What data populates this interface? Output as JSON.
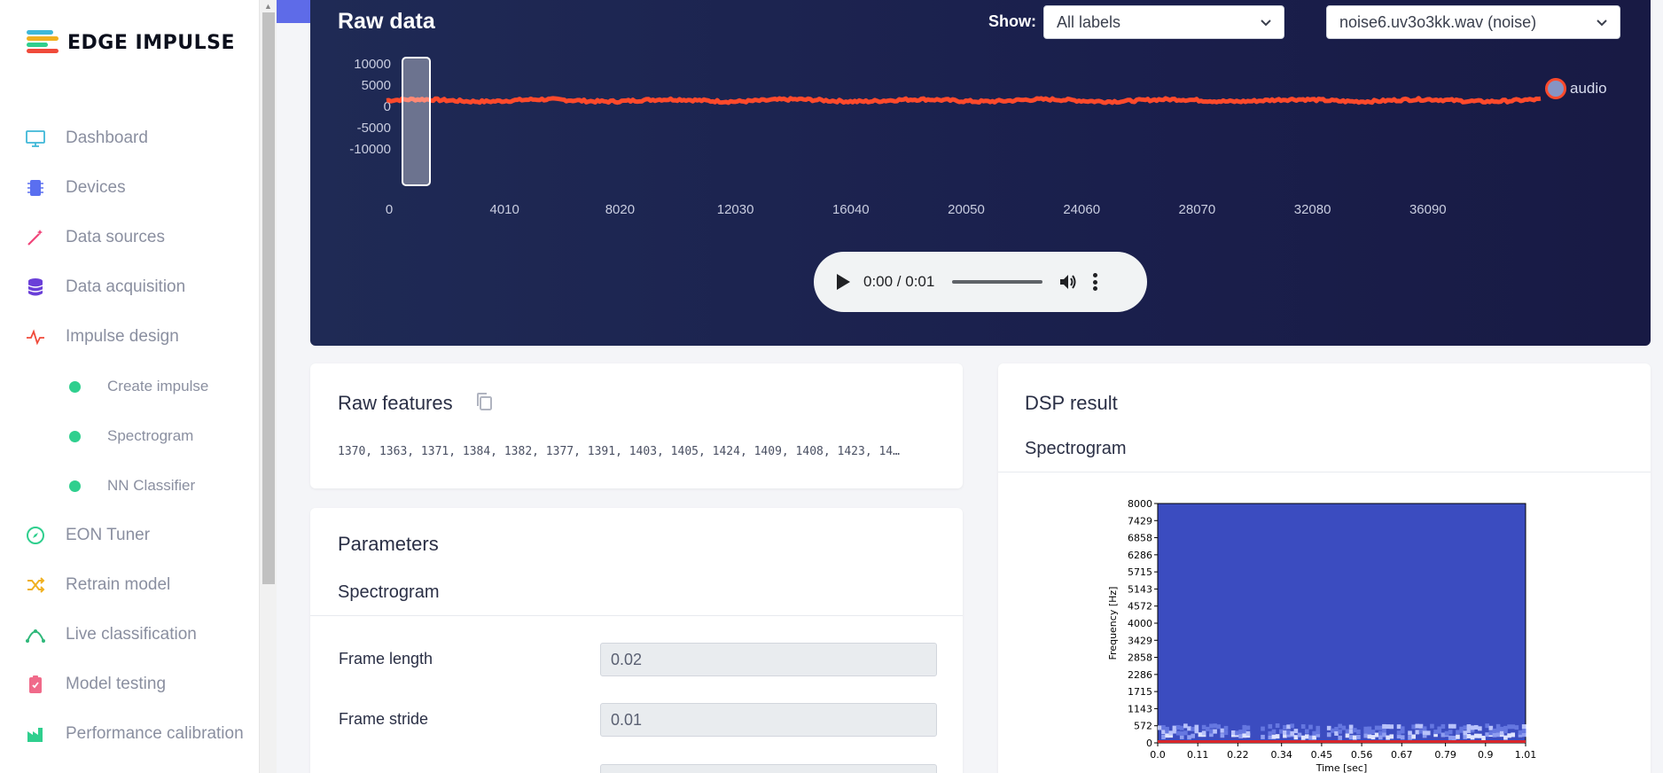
{
  "brand": {
    "name": "EDGE IMPULSE"
  },
  "nav": {
    "items": [
      {
        "label": "Dashboard",
        "icon": "monitor-icon",
        "color": "#3fb8d8"
      },
      {
        "label": "Devices",
        "icon": "chip-icon",
        "color": "#5a6ff0"
      },
      {
        "label": "Data sources",
        "icon": "wand-icon",
        "color": "#f0457a"
      },
      {
        "label": "Data acquisition",
        "icon": "database-icon",
        "color": "#6a3fd8"
      },
      {
        "label": "Impulse design",
        "icon": "pulse-icon",
        "color": "#f04a3a"
      }
    ],
    "sub_items": [
      {
        "label": "Create impulse"
      },
      {
        "label": "Spectrogram"
      },
      {
        "label": "NN Classifier"
      }
    ],
    "items_after": [
      {
        "label": "EON Tuner",
        "icon": "compass-icon",
        "color": "#2fcf8e"
      },
      {
        "label": "Retrain model",
        "icon": "shuffle-icon",
        "color": "#f0b020"
      },
      {
        "label": "Live classification",
        "icon": "curve-icon",
        "color": "#2fb87a"
      },
      {
        "label": "Model testing",
        "icon": "clipboard-icon",
        "color": "#f06a8a"
      },
      {
        "label": "Performance calibration",
        "icon": "factory-icon",
        "color": "#2fcf8e"
      }
    ]
  },
  "raw_data": {
    "title": "Raw data",
    "show_label": "Show:",
    "label_filter": "All labels",
    "sample_select": "noise6.uv3o3kk.wav (noise)",
    "legend": "audio",
    "player_time": "0:00 / 0:01"
  },
  "chart_data": [
    {
      "type": "line",
      "title": "",
      "series": [
        {
          "name": "audio",
          "color": "#ff4a2c",
          "values": [
            1370,
            1363,
            1371,
            1384,
            1382,
            1377,
            1391,
            1403,
            1405,
            1424,
            1409,
            1408,
            1423
          ]
        }
      ],
      "x_ticks": [
        "0",
        "4010",
        "8020",
        "12030",
        "16040",
        "20050",
        "24060",
        "28070",
        "32080",
        "36090"
      ],
      "y_ticks": [
        "10000",
        "5000",
        "0",
        "-5000",
        "-10000"
      ],
      "ylim": [
        -10000,
        10000
      ],
      "xlim": [
        0,
        40100
      ],
      "legend_placement": "right"
    },
    {
      "type": "heatmap",
      "title": "Spectrogram",
      "xlabel": "Time [sec]",
      "ylabel": "Frequency [Hz]",
      "x_ticks": [
        "0.0",
        "0.11",
        "0.22",
        "0.34",
        "0.45",
        "0.56",
        "0.67",
        "0.79",
        "0.9",
        "1.01"
      ],
      "y_ticks": [
        "0",
        "572",
        "1143",
        "1715",
        "2286",
        "2858",
        "3429",
        "4000",
        "4572",
        "5143",
        "5715",
        "6286",
        "6858",
        "7429",
        "8000"
      ],
      "xlim": [
        0,
        1.01
      ],
      "ylim": [
        0,
        8000
      ]
    }
  ],
  "raw_features": {
    "title": "Raw features",
    "values": "1370, 1363, 1371, 1384, 1382, 1377, 1391, 1403, 1405, 1424, 1409, 1408, 1423, 14…"
  },
  "parameters": {
    "title": "Parameters",
    "section": "Spectrogram",
    "fields": [
      {
        "label": "Frame length",
        "value": "0.02"
      },
      {
        "label": "Frame stride",
        "value": "0.01"
      }
    ]
  },
  "dsp": {
    "title": "DSP result",
    "section": "Spectrogram"
  }
}
